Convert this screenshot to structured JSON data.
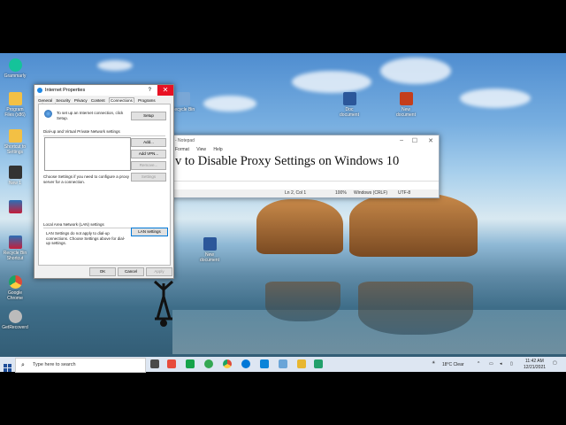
{
  "desktop": {
    "icons": [
      {
        "label": "Grammarly",
        "color": "#15c39a"
      },
      {
        "label": "Program Files (x86)",
        "color": "#f3c044"
      },
      {
        "label": "Shortcut to Settings",
        "color": "#f3c044"
      },
      {
        "label": "New 1",
        "color": "#333"
      },
      {
        "label": "",
        "color": "#2b6fb6"
      },
      {
        "label": "Recycle Bin Shortcut",
        "color": "#2b6fb6"
      },
      {
        "label": "Google Chrome",
        "color": "#dd4b39"
      },
      {
        "label": "GetRecoverd",
        "color": "#888"
      },
      {
        "label": "Recycle Bin",
        "color": "#7aa7d6"
      },
      {
        "label": "Doc document",
        "color": "#2b579a"
      },
      {
        "label": "New document",
        "color": "#c43e1c"
      },
      {
        "label": "New document",
        "color": "#2b579a"
      }
    ]
  },
  "notepad": {
    "title": "- Notepad",
    "menu": [
      "Format",
      "View",
      "Help"
    ],
    "text": "v to Disable Proxy Settings on Windows 10",
    "status": {
      "position": "Ln 2, Col 1",
      "zoom": "100%",
      "line_ending": "Windows (CRLF)",
      "encoding": "UTF-8"
    }
  },
  "internet_properties": {
    "title": "Internet Properties",
    "help": "?",
    "close": "✕",
    "tabs": [
      "General",
      "Security",
      "Privacy",
      "Content",
      "Connections",
      "Programs",
      "Advanced"
    ],
    "setup_text": "To set up an Internet connection, click Setup.",
    "setup_button": "Setup",
    "dialup_heading": "Dial-up and Virtual Private Network settings",
    "add_button": "Add...",
    "add_vpn_button": "Add VPN...",
    "remove_button": "Remove...",
    "settings_button": "Settings",
    "proxy_text": "Choose Settings if you need to configure a proxy server for a connection.",
    "lan_heading": "Local Area Network (LAN) settings",
    "lan_text": "LAN Settings do not apply to dial-up connections. Choose Settings above for dial-up settings.",
    "lan_button": "LAN settings",
    "ok": "OK",
    "cancel": "Cancel",
    "apply": "Apply"
  },
  "taskbar": {
    "search_placeholder": "Type here to search",
    "weather": "18°C  Clear",
    "time": "11:42 AM",
    "date": "12/21/2021",
    "apps": [
      "#4a4a4a",
      "#e74c3c",
      "#16a34a",
      "#34a853",
      "#4285f4",
      "#0078d7",
      "#0b84d9",
      "#6aa5d8",
      "#e8b730",
      "#2b6fb6",
      "#22a06b"
    ]
  }
}
